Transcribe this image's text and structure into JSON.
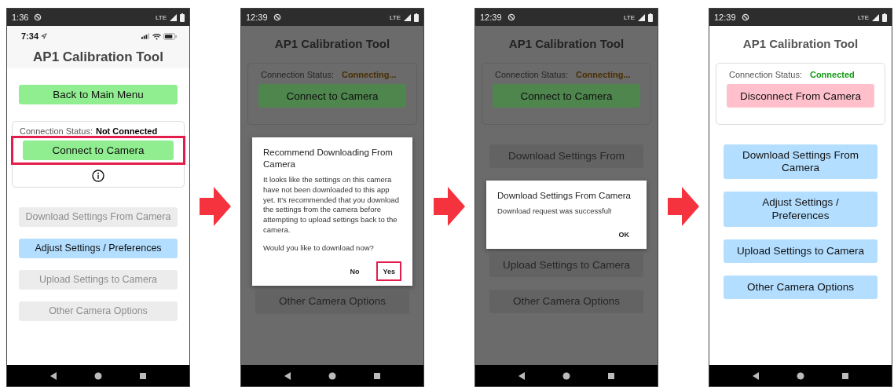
{
  "screens": [
    {
      "kind": "ios",
      "dimmed": false,
      "status_bar": {
        "time": "1:36",
        "network": "LTE"
      },
      "inner_status_bar": {
        "time": "7:34"
      },
      "title": "AP1 Calibration Tool",
      "header_buttons": [
        {
          "label": "Back to Main Menu",
          "color": "#90ee90",
          "disabled": false,
          "highlighted": false
        }
      ],
      "status_card": {
        "label": "Connection Status:",
        "value": "Not Connected",
        "color": "#000000",
        "buttons": [
          {
            "label": "Connect to Camera",
            "color": "#90ee90",
            "disabled": false,
            "highlighted": true
          }
        ]
      },
      "menu_buttons": [
        {
          "label": "Download Settings From Camera",
          "disabled": true
        },
        {
          "label": "Adjust Settings / Preferences",
          "color": "#b3deff",
          "disabled": false
        },
        {
          "label": "Upload Settings to Camera",
          "disabled": true
        },
        {
          "label": "Other Camera Options",
          "disabled": true
        }
      ]
    },
    {
      "kind": "android",
      "dimmed": true,
      "status_bar": {
        "time": "12:39",
        "network": "LTE"
      },
      "title": "AP1 Calibration Tool",
      "status_card": {
        "label": "Connection Status:",
        "value": "Connecting...",
        "color": "#4a2e00",
        "buttons": [
          {
            "label": "Connect to Camera",
            "color": "#4e864e",
            "disabled": false,
            "highlighted": false
          }
        ]
      },
      "dialog": {
        "title": "Recommend Downloading From Camera",
        "message": [
          "It looks like the settings on this camera have not been downloaded to this app yet. It's recommended that you download the settings from the camera before attempting to upload settings back to the camera.",
          "Would you like to download now?"
        ],
        "actions": [
          {
            "label": "No",
            "highlighted": false
          },
          {
            "label": "Yes",
            "highlighted": true
          }
        ]
      },
      "lower_buttons": [
        {
          "label": "Other Camera Options",
          "disabled": true
        }
      ]
    },
    {
      "kind": "android",
      "dimmed": true,
      "status_bar": {
        "time": "12:39",
        "network": "LTE"
      },
      "title": "AP1 Calibration Tool",
      "status_card": {
        "label": "Connection Status:",
        "value": "Connecting...",
        "color": "#4a2e00",
        "buttons": [
          {
            "label": "Connect to Camera",
            "color": "#4e864e",
            "disabled": false,
            "highlighted": false
          }
        ]
      },
      "menu_buttons": [
        {
          "label": "Download Settings From",
          "disabled": true
        }
      ],
      "dialog": {
        "title": "Download Settings From Camera",
        "message": [
          "Download request was successful!"
        ],
        "actions": [
          {
            "label": "OK",
            "highlighted": false
          }
        ]
      },
      "lower_buttons": [
        {
          "label": "Upload Settings to Camera",
          "disabled": true
        },
        {
          "label": "Other Camera Options",
          "disabled": true
        }
      ]
    },
    {
      "kind": "android",
      "dimmed": false,
      "status_bar": {
        "time": "12:39",
        "network": "LTE"
      },
      "title": "AP1 Calibration Tool",
      "status_card": {
        "label": "Connection Status:",
        "value": "Connected",
        "color": "#119911",
        "buttons": [
          {
            "label": "Disconnect From Camera",
            "color": "#ffc0cb",
            "disabled": false,
            "highlighted": false
          }
        ]
      },
      "menu_buttons": [
        {
          "label": "Download Settings From Camera",
          "color": "#b3deff",
          "disabled": false
        },
        {
          "label": "Adjust Settings / Preferences",
          "color": "#b3deff",
          "disabled": false
        },
        {
          "label": "Upload Settings to Camera",
          "color": "#b3deff",
          "disabled": false
        },
        {
          "label": "Other Camera Options",
          "color": "#b3deff",
          "disabled": false
        }
      ]
    }
  ]
}
